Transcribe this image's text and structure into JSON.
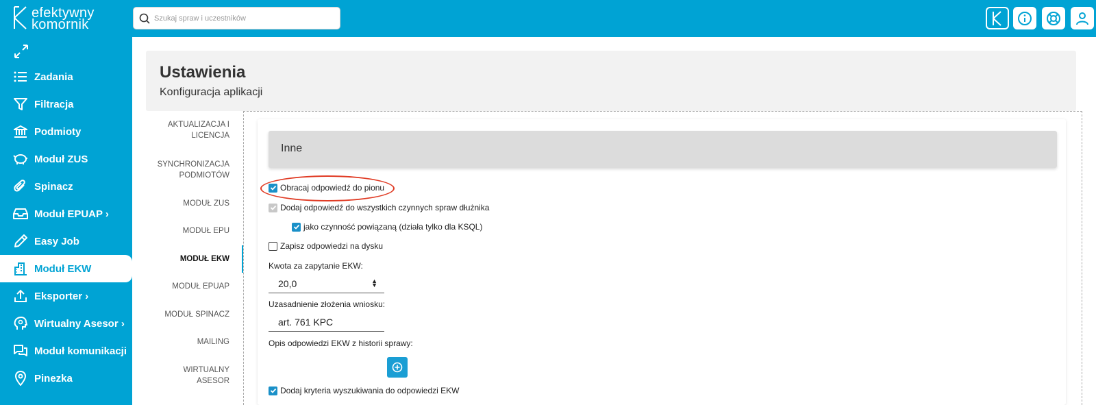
{
  "brand": {
    "line1": "efektywny",
    "line2": "komornik"
  },
  "search": {
    "placeholder": "Szukaj spraw i uczestników"
  },
  "sidebar": {
    "items": [
      {
        "label": "Zadania"
      },
      {
        "label": "Filtracja"
      },
      {
        "label": "Podmioty"
      },
      {
        "label": "Moduł ZUS"
      },
      {
        "label": "Spinacz"
      },
      {
        "label": "Moduł EPUAP ›"
      },
      {
        "label": "Easy Job"
      },
      {
        "label": "Moduł EKW"
      },
      {
        "label": "Eksporter ›"
      },
      {
        "label": "Wirtualny Asesor ›"
      },
      {
        "label": "Moduł komunikacji"
      },
      {
        "label": "Pinezka"
      }
    ]
  },
  "header": {
    "title": "Ustawienia",
    "subtitle": "Konfiguracja aplikacji"
  },
  "tabs": [
    {
      "line1": "AKTUALIZACJA I",
      "line2": "LICENCJA"
    },
    {
      "line1": "SYNCHRONIZACJA",
      "line2": "PODMIOTÓW"
    },
    {
      "line1": "MODUŁ ZUS",
      "line2": ""
    },
    {
      "line1": "MODUŁ EPU",
      "line2": ""
    },
    {
      "line1": "MODUŁ EKW",
      "line2": ""
    },
    {
      "line1": "MODUŁ EPUAP",
      "line2": ""
    },
    {
      "line1": "MODUŁ SPINACZ",
      "line2": ""
    },
    {
      "line1": "MAILING",
      "line2": ""
    },
    {
      "line1": "WIRTUALNY",
      "line2": "ASESOR"
    }
  ],
  "section": {
    "title": "Inne",
    "checkboxes": [
      {
        "label": "Obracaj odpowiedź do pionu",
        "checked": true
      },
      {
        "label": "Dodaj odpowiedź do wszystkich czynnych spraw dłużnika",
        "checked": true,
        "disabled": true
      },
      {
        "label": "jako czynność powiązaną (działa tylko dla KSQL)",
        "checked": true
      },
      {
        "label": "Zapisz odpowiedzi na dysku",
        "checked": false
      },
      {
        "label": "Dodaj kryteria wyszukiwania do odpowiedzi EKW",
        "checked": true
      }
    ],
    "fields": {
      "kwota_label": "Kwota za zapytanie EKW:",
      "kwota_value": "20,0",
      "uzasadnienie_label": "Uzasadnienie złożenia wniosku:",
      "uzasadnienie_value": "art. 761 KPC",
      "opis_label": "Opis odpowiedzi EKW z historii sprawy:"
    }
  },
  "colors": {
    "brand": "#00a3d4",
    "checkbox": "#1a90c8",
    "highlight": "#e03b24"
  }
}
